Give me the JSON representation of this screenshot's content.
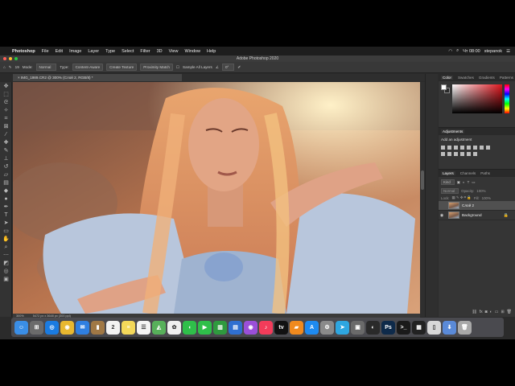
{
  "menubar": {
    "apple_icon": "apple-logo-icon",
    "app_name": "Photoshop",
    "items": [
      "File",
      "Edit",
      "Image",
      "Layer",
      "Type",
      "Select",
      "Filter",
      "3D",
      "View",
      "Window",
      "Help"
    ],
    "clock": "Чт 08:00",
    "user": "stepanok"
  },
  "window": {
    "title": "Adobe Photoshop 2020"
  },
  "options_bar": {
    "brush_size": "19",
    "mode_label": "Mode:",
    "mode_value": "Normal",
    "type_label": "Type:",
    "type_options": [
      "Content-Aware",
      "Create Texture",
      "Proximity Match"
    ],
    "sample_all_layers": "Sample All Layers",
    "angle_value": "0°"
  },
  "document": {
    "tab_title": "IMG_1989.CR2 @ 300% (Слой 2, RGB/8) *",
    "zoom": "300%",
    "dimensions": "5472 px x 3648 px (300 ppi)"
  },
  "color_panel": {
    "tabs": [
      "Color",
      "Swatches",
      "Gradients",
      "Patterns"
    ],
    "foreground": "#ffffff",
    "background": "#2a2a2a",
    "hue_color": "#e0151d"
  },
  "adjustments_panel": {
    "title": "Adjustments",
    "add_label": "Add an adjustment"
  },
  "layers_panel": {
    "tabs": [
      "Layers",
      "Channels",
      "Paths"
    ],
    "kind_label": "Kind",
    "blend_mode": "Normal",
    "opacity_label": "Opacity:",
    "opacity_value": "100%",
    "lock_label": "Lock:",
    "fill_label": "Fill:",
    "fill_value": "100%",
    "layers": [
      {
        "name": "Слой 2",
        "selected": true,
        "visible": false
      },
      {
        "name": "Background",
        "selected": false,
        "visible": true
      }
    ]
  },
  "dock": {
    "apps": [
      {
        "icon": "finder-icon",
        "color": "#3a8ee6",
        "glyph": "☺"
      },
      {
        "icon": "launchpad-icon",
        "color": "#6b6b6b",
        "glyph": "⊞"
      },
      {
        "icon": "safari-icon",
        "color": "#1a7be0",
        "glyph": "◎"
      },
      {
        "icon": "chrome-icon",
        "color": "#e8b830",
        "glyph": "◉"
      },
      {
        "icon": "mail-icon",
        "color": "#2f7fe0",
        "glyph": "✉"
      },
      {
        "icon": "contacts-icon",
        "color": "#a07845",
        "glyph": "▮"
      },
      {
        "icon": "calendar-icon",
        "color": "#f2f2f2",
        "glyph": "2"
      },
      {
        "icon": "notes-icon",
        "color": "#f3d85a",
        "glyph": "≡"
      },
      {
        "icon": "reminders-icon",
        "color": "#f4f4f4",
        "glyph": "☰"
      },
      {
        "icon": "maps-icon",
        "color": "#57b05a",
        "glyph": "◭"
      },
      {
        "icon": "photos-icon",
        "color": "#f0f0f0",
        "glyph": "✿"
      },
      {
        "icon": "messages-icon",
        "color": "#2fbf4a",
        "glyph": "◖"
      },
      {
        "icon": "facetime-icon",
        "color": "#2fbf4a",
        "glyph": "▶"
      },
      {
        "icon": "numbers-icon",
        "color": "#2f9a3e",
        "glyph": "▥"
      },
      {
        "icon": "keynote-icon",
        "color": "#2f6fd0",
        "glyph": "▤"
      },
      {
        "icon": "podcasts-icon",
        "color": "#9a4fd8",
        "glyph": "◉"
      },
      {
        "icon": "music-icon",
        "color": "#f23c5a",
        "glyph": "♪"
      },
      {
        "icon": "appletv-icon",
        "color": "#111111",
        "glyph": "tv"
      },
      {
        "icon": "books-icon",
        "color": "#f08a1e",
        "glyph": "▰"
      },
      {
        "icon": "appstore-icon",
        "color": "#1e8af0",
        "glyph": "A"
      },
      {
        "icon": "system-preferences-icon",
        "color": "#8a8a8a",
        "glyph": "⚙"
      },
      {
        "icon": "telegram-icon",
        "color": "#2ea6e0",
        "glyph": "➤"
      },
      {
        "icon": "screenshot-icon",
        "color": "#6a6a6a",
        "glyph": "▣"
      },
      {
        "icon": "obs-icon",
        "color": "#2a2a2a",
        "glyph": "◐"
      },
      {
        "icon": "photoshop-icon",
        "color": "#0e2a4a",
        "glyph": "Ps"
      },
      {
        "icon": "terminal-icon",
        "color": "#1a1a1a",
        "glyph": ">_"
      },
      {
        "icon": "activity-monitor-icon",
        "color": "#222222",
        "glyph": "▦"
      },
      {
        "icon": "preview-icon",
        "color": "#d8d8d8",
        "glyph": "▯"
      },
      {
        "icon": "downloads-icon",
        "color": "#5a8ad8",
        "glyph": "⬇"
      },
      {
        "icon": "trash-icon",
        "color": "#a8a8a8",
        "glyph": "🗑"
      }
    ]
  }
}
